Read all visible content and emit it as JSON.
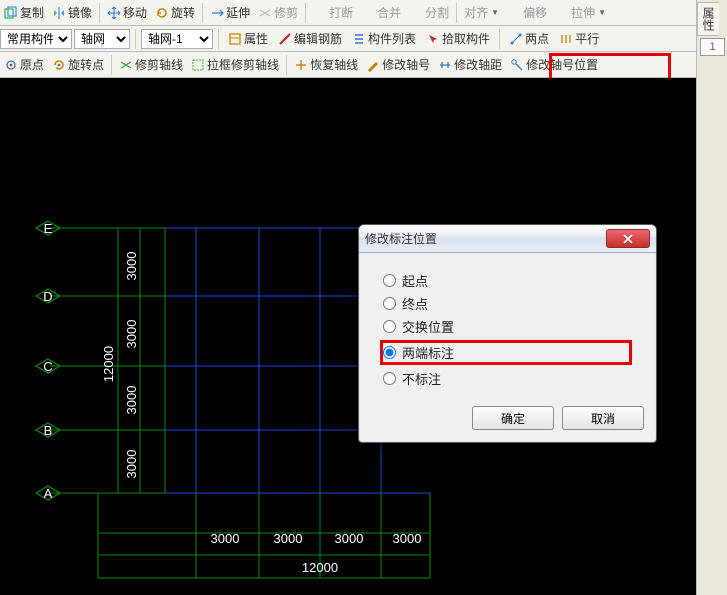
{
  "toolbar1": {
    "copy": "复制",
    "mirror": "镜像",
    "move": "移动",
    "rotate": "旋转",
    "extend": "延伸",
    "trim": "修剪",
    "break": "打断",
    "merge": "合并",
    "split": "分割",
    "align": "对齐",
    "offset": "偏移",
    "stretch": "拉伸"
  },
  "toolbar2": {
    "category": "常用构件",
    "type": "轴网",
    "instance": "轴网-1",
    "props": "属性",
    "editRebar": "编辑钢筋",
    "componentList": "构件列表",
    "pickComponent": "拾取构件",
    "twoPoint": "两点",
    "parallel": "平行"
  },
  "toolbar3": {
    "origin": "原点",
    "rotPoint": "旋转点",
    "trimAxis": "修剪轴线",
    "boxTrimAxis": "拉框修剪轴线",
    "restoreAxis": "恢复轴线",
    "editAxisNum": "修改轴号",
    "editAxisDist": "修改轴距",
    "editAxisNumPos": "修改轴号位置"
  },
  "rightTab": "属性",
  "rightCell": "1",
  "grid": {
    "rows": [
      "E",
      "D",
      "C",
      "B",
      "A"
    ],
    "rowDims": [
      "3000",
      "3000",
      "3000",
      "3000"
    ],
    "rowTotal": "12000",
    "colDims": [
      "3000",
      "3000",
      "3000",
      "3000"
    ],
    "colTotal": "12000"
  },
  "dialog": {
    "title": "修改标注位置",
    "opts": {
      "start": "起点",
      "end": "终点",
      "swap": "交换位置",
      "both": "两端标注",
      "none": "不标注"
    },
    "selected": "both",
    "ok": "确定",
    "cancel": "取消"
  }
}
